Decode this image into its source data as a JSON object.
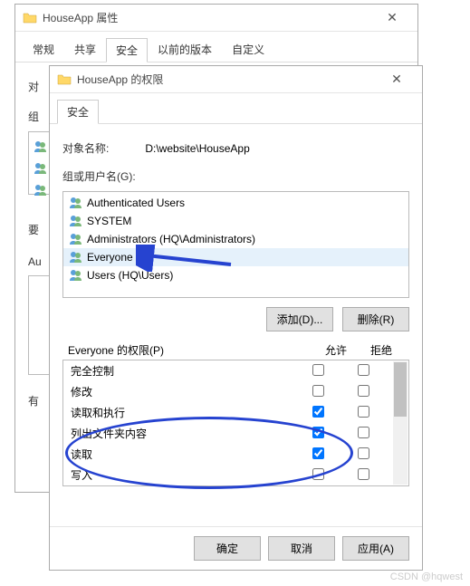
{
  "back_window": {
    "title": "HouseApp 属性",
    "tabs": [
      "常规",
      "共享",
      "安全",
      "以前的版本",
      "自定义"
    ],
    "active_tab_index": 2,
    "left_labels": [
      "对",
      "组",
      "要",
      "Au",
      "有"
    ]
  },
  "front_window": {
    "title": "HouseApp 的权限",
    "tabs": [
      "安全"
    ],
    "active_tab_index": 0,
    "object_label": "对象名称:",
    "object_value": "D:\\website\\HouseApp",
    "groups_label": "组或用户名(G):",
    "groups": [
      {
        "name": "Authenticated Users"
      },
      {
        "name": "SYSTEM"
      },
      {
        "name": "Administrators (HQ\\Administrators)"
      },
      {
        "name": "Everyone",
        "selected": true
      },
      {
        "name": "Users (HQ\\Users)"
      }
    ],
    "add_button": "添加(D)...",
    "remove_button": "删除(R)",
    "perm_label": "Everyone 的权限(P)",
    "allow_col": "允许",
    "deny_col": "拒绝",
    "permissions": [
      {
        "name": "完全控制",
        "allow": false,
        "deny": false
      },
      {
        "name": "修改",
        "allow": false,
        "deny": false
      },
      {
        "name": "读取和执行",
        "allow": true,
        "deny": false
      },
      {
        "name": "列出文件夹内容",
        "allow": true,
        "deny": false
      },
      {
        "name": "读取",
        "allow": true,
        "deny": false
      },
      {
        "name": "写入",
        "allow": false,
        "deny": false
      }
    ],
    "ok_button": "确定",
    "cancel_button": "取消",
    "apply_button": "应用(A)"
  },
  "watermark": "CSDN @hqwest"
}
